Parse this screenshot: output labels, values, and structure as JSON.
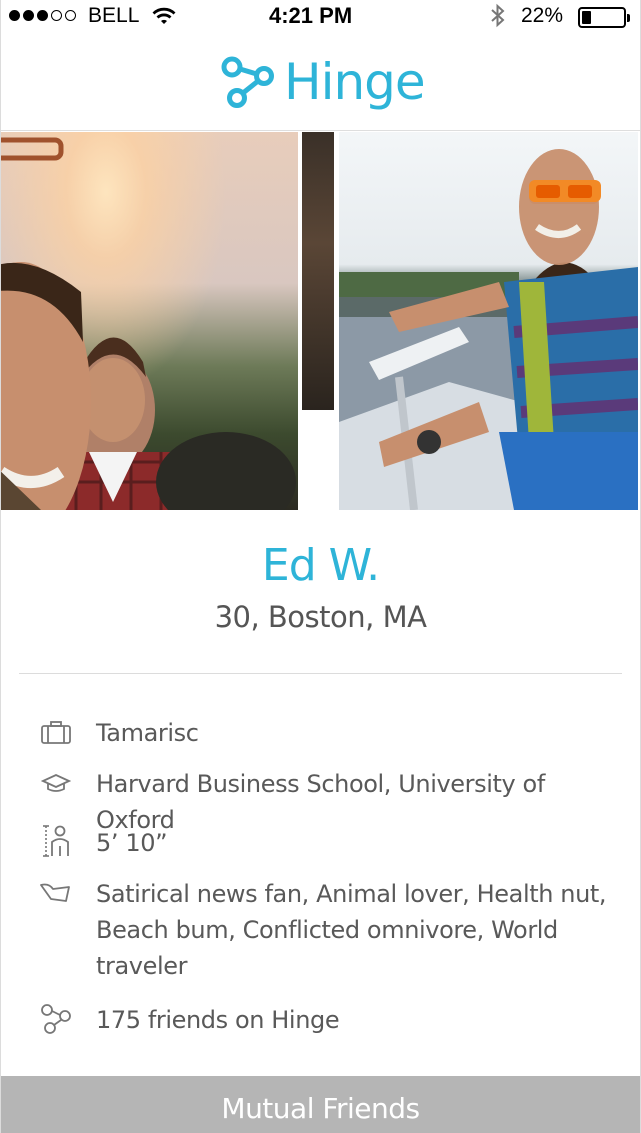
{
  "status_bar": {
    "signal_dots": 5,
    "signal_filled": 3,
    "carrier": "BELL",
    "time": "4:21 PM",
    "battery_percent": "22%",
    "battery_level": 0.22,
    "icons": [
      "wifi-icon",
      "bluetooth-icon",
      "battery-icon"
    ]
  },
  "header": {
    "logo_text": "Hinge",
    "brand_color": "#2eb4d8"
  },
  "photos": [
    {
      "name": "profile-photo-1",
      "description_icon": "photo"
    },
    {
      "name": "profile-photo-2",
      "description_icon": "photo"
    },
    {
      "name": "profile-photo-3",
      "description_icon": "photo"
    }
  ],
  "profile": {
    "name": "Ed W.",
    "age_location": "30, Boston, MA"
  },
  "details": [
    {
      "icon": "briefcase-icon",
      "text": "Tamarisc"
    },
    {
      "icon": "graduation-cap-icon",
      "text": "Harvard Business School, University of Oxford"
    },
    {
      "icon": "height-icon",
      "text": "5’ 10”"
    },
    {
      "icon": "tag-icon",
      "text": "Satirical news fan, Animal lover, Health nut, Beach bum, Conflicted omnivore,  World traveler"
    },
    {
      "icon": "hinge-friends-icon",
      "text": "175 friends on Hinge"
    }
  ],
  "footer": {
    "mutual_friends_label": "Mutual Friends",
    "bar_color": "#b5b5b5"
  }
}
